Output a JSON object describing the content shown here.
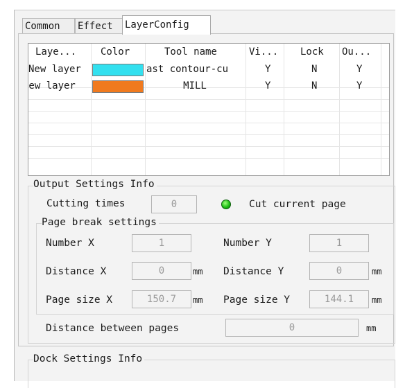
{
  "tabs": [
    {
      "label": "Common"
    },
    {
      "label": "Effect"
    },
    {
      "label": "LayerConfig",
      "active": true
    }
  ],
  "layer_table": {
    "headers": [
      "Laye...",
      "Color",
      "Tool name",
      "Vi...",
      "Lock",
      "Ou..."
    ],
    "rows": [
      {
        "layer": "New layer",
        "color": "#33e0ef",
        "tool": "ast contour-cu",
        "visible": "Y",
        "lock": "N",
        "output": "Y"
      },
      {
        "layer": "New layer",
        "color": "#f07a1f",
        "tool": "MILL",
        "visible": "Y",
        "lock": "N",
        "output": "Y"
      }
    ]
  },
  "output_settings": {
    "title": "Output Settings Info",
    "cutting_times_label": "Cutting times",
    "cutting_times_value": "0",
    "cut_current_page_label": "Cut current page",
    "cut_current_page_on": true
  },
  "page_break": {
    "title": "Page break settings",
    "number_x_label": "Number X",
    "number_x_value": "1",
    "number_y_label": "Number Y",
    "number_y_value": "1",
    "distance_x_label": "Distance X",
    "distance_x_value": "0",
    "distance_y_label": "Distance Y",
    "distance_y_value": "0",
    "page_size_x_label": "Page size X",
    "page_size_x_value": "150.7",
    "page_size_y_label": "Page size Y",
    "page_size_y_value": "144.1",
    "unit": "mm"
  },
  "distance_between_pages": {
    "label": "Distance between pages",
    "value": "0",
    "unit": "mm"
  },
  "dock_settings": {
    "title": "Dock Settings Info"
  },
  "colors": {
    "led_green": "#1fbf16",
    "panel_bg": "#f3f3f3"
  }
}
